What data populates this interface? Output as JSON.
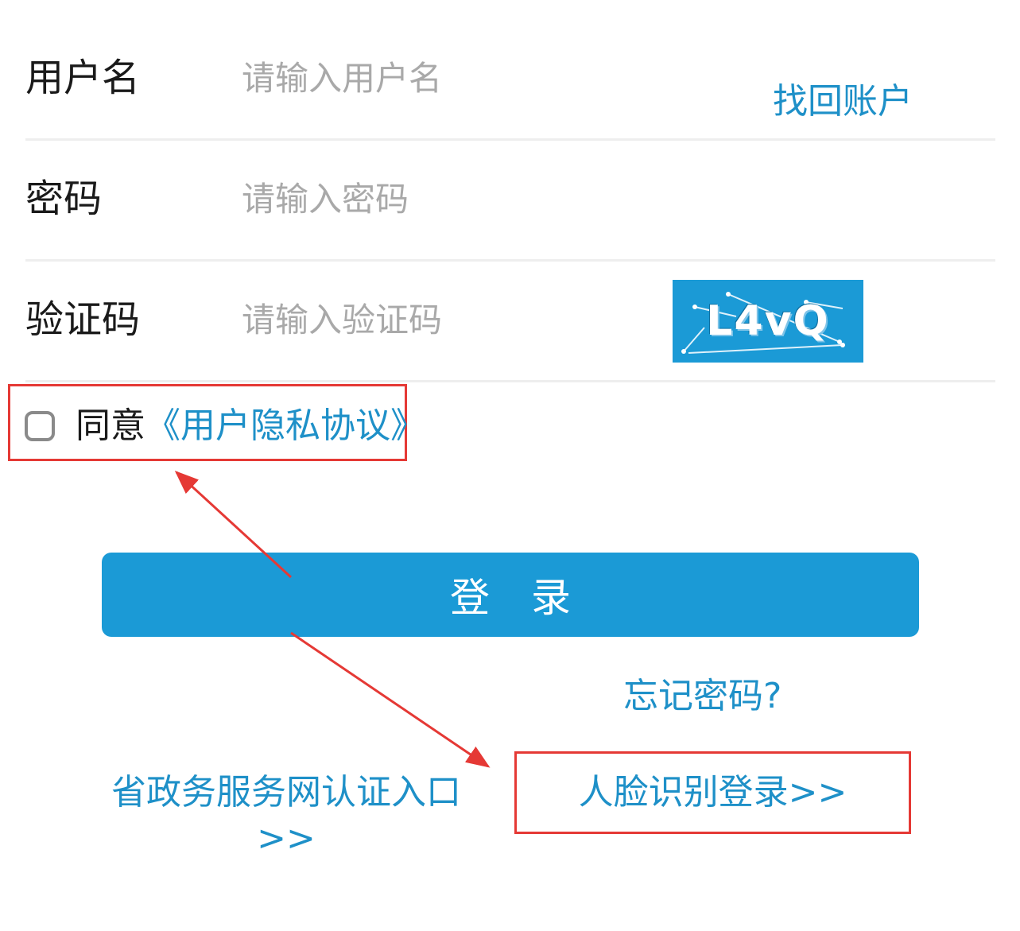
{
  "form": {
    "username": {
      "label": "用户名",
      "placeholder": "请输入用户名"
    },
    "password": {
      "label": "密码",
      "placeholder": "请输入密码"
    },
    "captcha": {
      "label": "验证码",
      "placeholder": "请输入验证码",
      "image_text": "L4vQ"
    },
    "find_account": "找回账户"
  },
  "agreement": {
    "prefix": "同意",
    "link": "《用户隐私协议》"
  },
  "login_button": "登 录",
  "forgot_password": "忘记密码?",
  "portal_link": {
    "line1": "省政务服务网认证入口",
    "line2": ">>"
  },
  "face_login": "人脸识别登录>>",
  "colors": {
    "accent": "#1b9ad6",
    "link": "#1e90c8",
    "annotation": "#e53935"
  }
}
